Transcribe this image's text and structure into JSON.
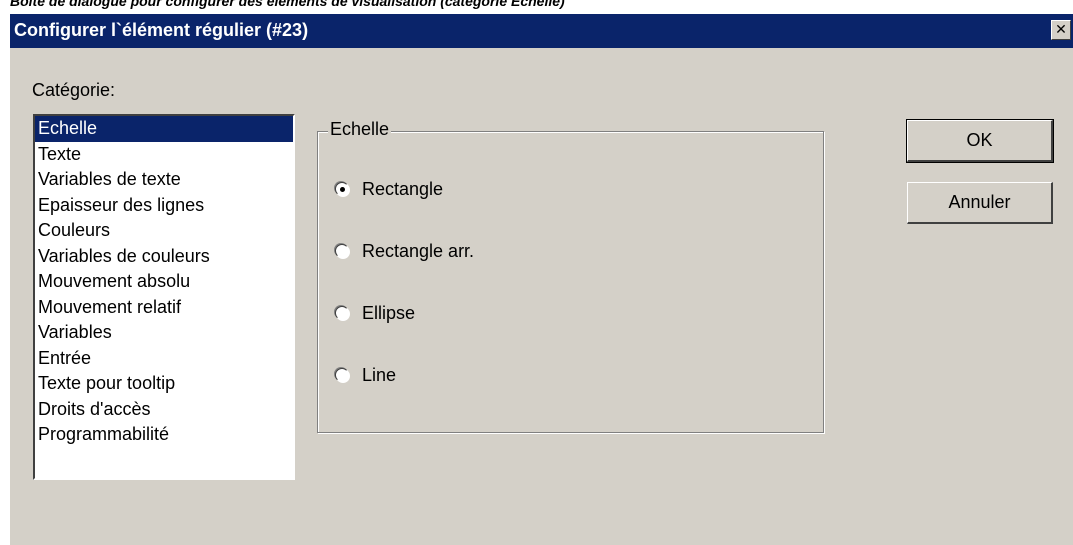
{
  "caption": "Boîte de dialogue pour configurer des éléments de visualisation (catégorie Echelle)",
  "dialog": {
    "title": "Configurer l`élément régulier (#23)",
    "close_label": "✕"
  },
  "category": {
    "label": "Catégorie:",
    "items": [
      "Echelle",
      "Texte",
      "Variables de texte",
      "Epaisseur des lignes",
      "Couleurs",
      "Variables de couleurs",
      "Mouvement absolu",
      "Mouvement relatif",
      "Variables",
      "Entrée",
      "Texte pour tooltip",
      "Droits d'accès",
      "Programmabilité"
    ],
    "selected": "Echelle"
  },
  "shape_group": {
    "legend": "Echelle",
    "options": [
      "Rectangle",
      "Rectangle arr.",
      "Ellipse",
      "Line"
    ],
    "selected": "Rectangle"
  },
  "buttons": {
    "ok": "OK",
    "cancel": "Annuler"
  }
}
